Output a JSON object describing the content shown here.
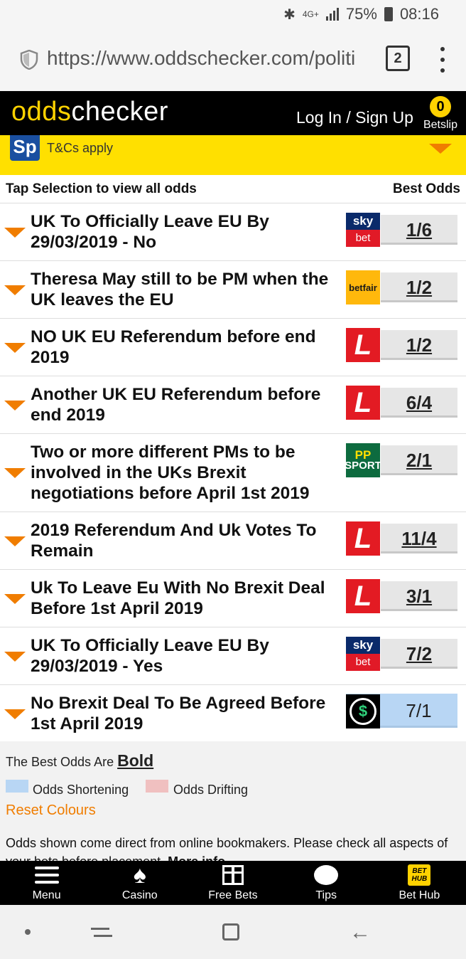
{
  "status_bar": {
    "network": "4G+",
    "battery": "75%",
    "time": "08:16"
  },
  "browser": {
    "url": "https://www.oddschecker.com/politi",
    "tab_count": "2"
  },
  "site": {
    "logo_prefix": "odds",
    "logo_suffix": "checker",
    "login_label": "Log In / Sign Up",
    "betslip_count": "0",
    "betslip_label": "Betslip"
  },
  "promo": {
    "badge": "Sp",
    "terms": "T&Cs apply"
  },
  "list_header": {
    "left": "Tap Selection to view all odds",
    "right": "Best Odds"
  },
  "markets": [
    {
      "title_1": "UK To Officially Leave EU By",
      "title_2": "29/03/2019 - No",
      "bookmaker": "sky-bet",
      "bk_top": "sky",
      "bk_bottom": "bet",
      "odds": "1/6",
      "shortening": false
    },
    {
      "title_1": "Theresa May still to be PM when the",
      "title_2": "UK leaves the EU",
      "bookmaker": "betfair",
      "bk_text": "betfair",
      "odds": "1/2",
      "shortening": false
    },
    {
      "title_1": "NO UK EU Referendum before end",
      "title_2": "2019",
      "bookmaker": "ladbrokes",
      "odds": "1/2",
      "shortening": false
    },
    {
      "title_1": "Another UK EU Referendum before",
      "title_2": "end 2019",
      "bookmaker": "ladbrokes",
      "odds": "6/4",
      "shortening": false
    },
    {
      "title_1": "Two or more different PMs to be",
      "title_2": "involved in the UKs Brexit",
      "title_3": "negotiations before April 1st 2019",
      "bookmaker": "paddy-power-sport",
      "bk_top": "PP",
      "bk_bottom": "SPORT",
      "odds": "2/1",
      "shortening": false
    },
    {
      "title_1": "2019 Referendum And Uk Votes To",
      "title_2": "Remain",
      "bookmaker": "ladbrokes",
      "odds": "11/4",
      "shortening": false
    },
    {
      "title_1": "Uk To Leave Eu With No Brexit Deal",
      "title_2": "Before 1st April 2019",
      "bookmaker": "ladbrokes",
      "odds": "3/1",
      "shortening": false
    },
    {
      "title_1": "UK To Officially Leave EU By",
      "title_2": "29/03/2019 - Yes",
      "bookmaker": "sky-bet",
      "bk_top": "sky",
      "bk_bottom": "bet",
      "odds": "7/2",
      "shortening": false
    },
    {
      "title_1": "No Brexit Deal To Be Agreed Before",
      "title_2": "1st April 2019",
      "bookmaker": "sport-nation",
      "odds": "7/1",
      "shortening": true
    }
  ],
  "legend": {
    "best_prefix": "The Best Odds Are",
    "best_word": "Bold",
    "shortening": "Odds Shortening",
    "drifting": "Odds Drifting",
    "reset": "Reset Colours",
    "disclaimer": "Odds shown come direct from online bookmakers. Please check all aspects of your bets before placement.",
    "more_info": "More info"
  },
  "bottom_nav": {
    "menu": "Menu",
    "casino": "Casino",
    "free_bets": "Free Bets",
    "tips": "Tips",
    "bet_hub": "Bet Hub",
    "bet_hub_badge_1": "BET",
    "bet_hub_badge_2": "HUB"
  },
  "colors": {
    "brand_yellow": "#ffd200",
    "accent_orange": "#f07d00",
    "shortening_blue": "#b8d6f4",
    "drifting_pink": "#f0c0c0"
  }
}
